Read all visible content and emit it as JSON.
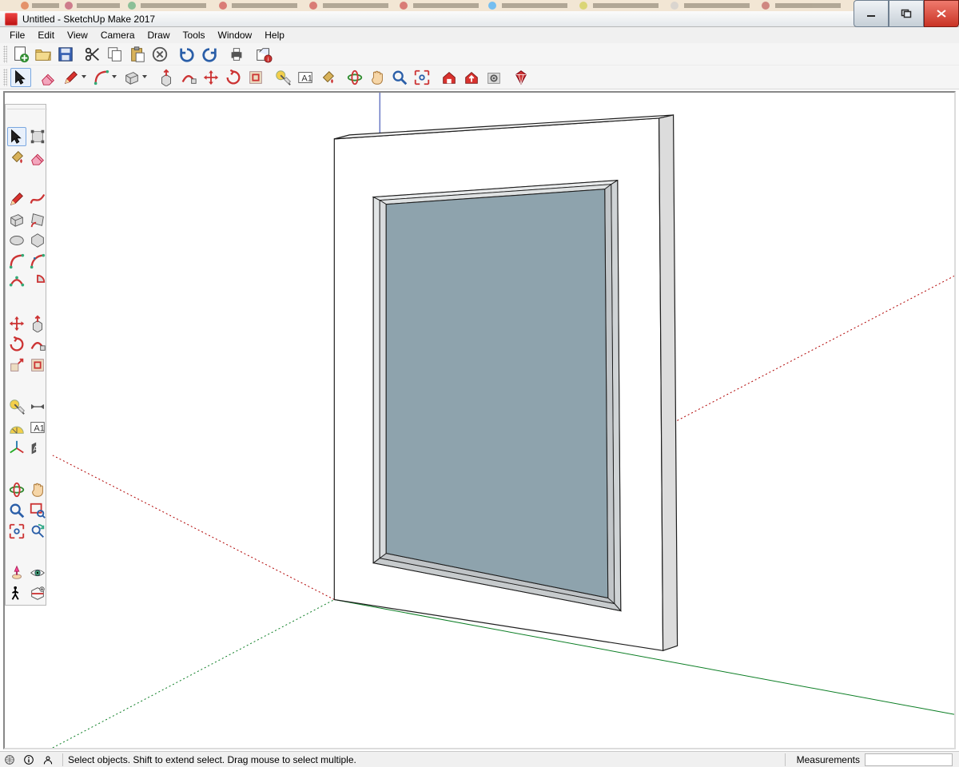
{
  "window": {
    "title": "Untitled - SketchUp Make 2017"
  },
  "menubar": {
    "items": [
      "File",
      "Edit",
      "View",
      "Camera",
      "Draw",
      "Tools",
      "Window",
      "Help"
    ]
  },
  "toolbar_top": {
    "items": [
      {
        "name": "new-from-template",
        "icon": "newdoc"
      },
      {
        "name": "open",
        "icon": "folder"
      },
      {
        "name": "save",
        "icon": "disk"
      },
      {
        "name": "sep"
      },
      {
        "name": "cut",
        "icon": "scissors"
      },
      {
        "name": "copy",
        "icon": "copy"
      },
      {
        "name": "paste",
        "icon": "paste"
      },
      {
        "name": "delete",
        "icon": "xcircle"
      },
      {
        "name": "sep"
      },
      {
        "name": "undo",
        "icon": "undo"
      },
      {
        "name": "redo",
        "icon": "redo"
      },
      {
        "name": "sep"
      },
      {
        "name": "print",
        "icon": "printer"
      },
      {
        "name": "sep"
      },
      {
        "name": "model-info",
        "icon": "model"
      }
    ]
  },
  "toolbar_tools": {
    "items": [
      {
        "name": "select",
        "icon": "cursor",
        "active": true
      },
      {
        "name": "sep"
      },
      {
        "name": "eraser",
        "icon": "eraser"
      },
      {
        "name": "line",
        "icon": "pencil",
        "dropdown": true
      },
      {
        "name": "arc",
        "icon": "arc",
        "dropdown": true
      },
      {
        "name": "rectangle",
        "icon": "rect",
        "dropdown": true
      },
      {
        "name": "sep"
      },
      {
        "name": "pushpull",
        "icon": "pushpull"
      },
      {
        "name": "followme",
        "icon": "followme"
      },
      {
        "name": "move",
        "icon": "move4"
      },
      {
        "name": "rotate",
        "icon": "rotate"
      },
      {
        "name": "offset",
        "icon": "offset"
      },
      {
        "name": "sep"
      },
      {
        "name": "tape",
        "icon": "tape"
      },
      {
        "name": "text",
        "icon": "textA"
      },
      {
        "name": "paint",
        "icon": "bucket"
      },
      {
        "name": "sep"
      },
      {
        "name": "orbit",
        "icon": "orbit"
      },
      {
        "name": "pan",
        "icon": "hand"
      },
      {
        "name": "zoom",
        "icon": "mag"
      },
      {
        "name": "zoom-extents",
        "icon": "zoomext"
      },
      {
        "name": "sep"
      },
      {
        "name": "warehouse-get",
        "icon": "wh1"
      },
      {
        "name": "warehouse-share",
        "icon": "wh2"
      },
      {
        "name": "extension-warehouse",
        "icon": "wh3"
      },
      {
        "name": "sep"
      },
      {
        "name": "extension-manager",
        "icon": "ruby"
      }
    ]
  },
  "toolbox_side": {
    "rows": [
      [
        "select",
        "makecomp"
      ],
      [
        "bucket",
        "eraser"
      ],
      [
        "gap"
      ],
      [
        "pencil",
        "freehand"
      ],
      [
        "rect",
        "rotrect"
      ],
      [
        "circle",
        "polygon"
      ],
      [
        "arc",
        "arc2pt"
      ],
      [
        "arc3pt",
        "pie"
      ],
      [
        "gap"
      ],
      [
        "move4",
        "pushpull"
      ],
      [
        "rotate",
        "followme"
      ],
      [
        "scale",
        "offset"
      ],
      [
        "gap"
      ],
      [
        "tape",
        "dim"
      ],
      [
        "protractor",
        "textA"
      ],
      [
        "axes",
        "3dtext"
      ],
      [
        "gap"
      ],
      [
        "orbit",
        "hand"
      ],
      [
        "mag",
        "zoomwin"
      ],
      [
        "zoomext",
        "prevview"
      ],
      [
        "gap"
      ],
      [
        "camera",
        "lookaround"
      ],
      [
        "walk",
        "section"
      ]
    ]
  },
  "status": {
    "hint": "Select objects. Shift to extend select. Drag mouse to select multiple.",
    "measurements_label": "Measurements",
    "measurements_value": ""
  }
}
